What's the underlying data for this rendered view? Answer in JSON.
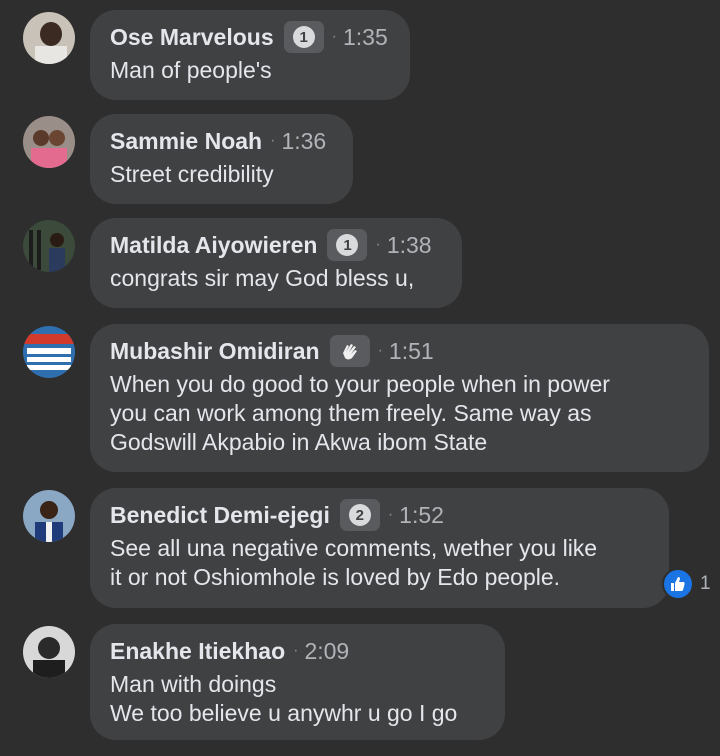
{
  "comments": [
    {
      "name": "Ose Marvelous",
      "badge": "1",
      "time": "1:35",
      "lines": [
        "Man of people's"
      ]
    },
    {
      "name": "Sammie Noah",
      "time": "1:36",
      "lines": [
        "Street  credibility"
      ]
    },
    {
      "name": "Matilda Aiyowieren",
      "badge": "1",
      "time": "1:38",
      "lines": [
        "congrats sir may God bless u,"
      ]
    },
    {
      "name": "Mubashir Omidiran",
      "badge_icon": "clapping-hands-icon",
      "time": "1:51",
      "lines": [
        "When you do good to your people when in power",
        "you can work among them freely. Same way as",
        "Godswill Akpabio in Akwa ibom State"
      ]
    },
    {
      "name": "Benedict Demi-ejegi",
      "badge": "2",
      "time": "1:52",
      "lines": [
        "See all una negative comments, wether you like",
        "it or not Oshiomhole is loved by Edo people."
      ],
      "reaction": {
        "icon": "like-icon",
        "count": "1"
      }
    },
    {
      "name": "Enakhe Itiekhao",
      "time": "2:09",
      "lines": [
        "Man with doings",
        "We too believe u anywhr u go I go"
      ]
    }
  ],
  "colors": {
    "background": "#2e2e2f",
    "bubble": "#404143",
    "like": "#1b74e4"
  }
}
